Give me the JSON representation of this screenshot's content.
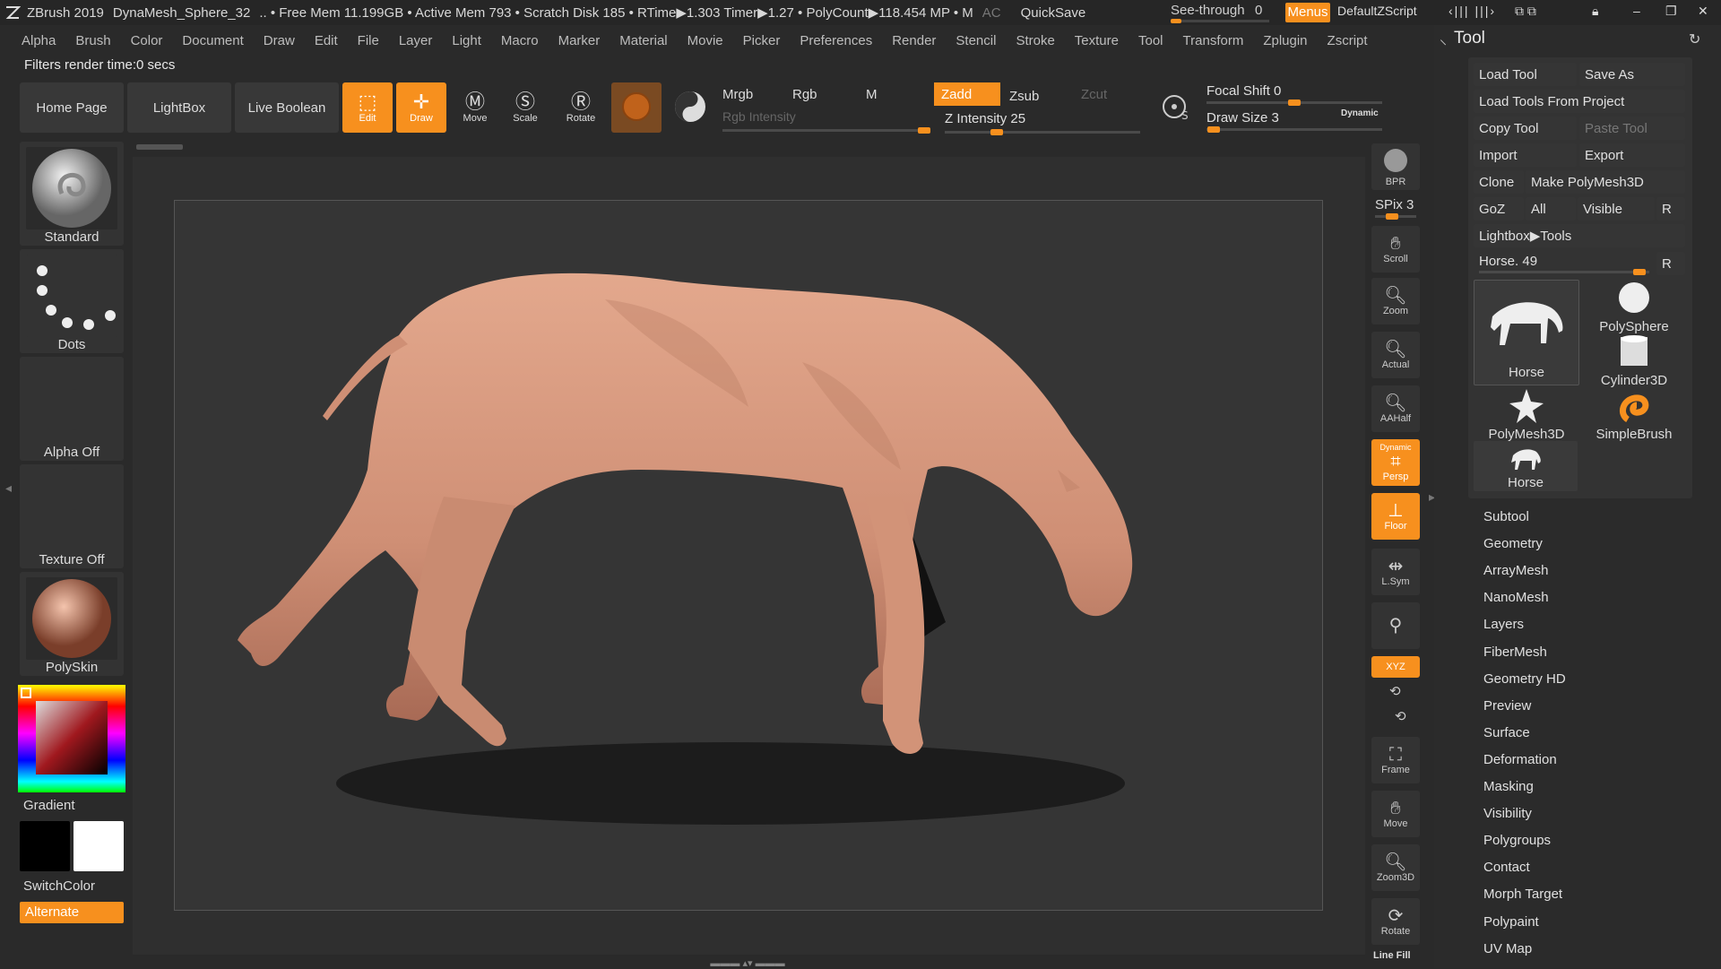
{
  "titlebar": {
    "app": "ZBrush 2019",
    "doc": "DynaMesh_Sphere_32",
    "stats": ".. • Free Mem 11.199GB • Active Mem 793 • Scratch Disk 185 • RTime▶1.303 Timer▶1.27 • PolyCount▶118.454 MP • M",
    "ac": "AC",
    "quicksave": "QuickSave",
    "seethrough_label": "See-through",
    "seethrough_value": "0",
    "seethrough_level": 0,
    "menus": "Menus",
    "script": "DefaultZScript"
  },
  "menubar": [
    "Alpha",
    "Brush",
    "Color",
    "Document",
    "Draw",
    "Edit",
    "File",
    "Layer",
    "Light",
    "Macro",
    "Marker",
    "Material",
    "Movie",
    "Picker",
    "Preferences",
    "Render",
    "Stencil",
    "Stroke",
    "Texture",
    "Tool",
    "Transform",
    "Zplugin",
    "Zscript"
  ],
  "status": "Filters render time:0 secs",
  "toolbar": {
    "home": "Home Page",
    "lightbox": "LightBox",
    "liveboolean": "Live Boolean",
    "edit": "Edit",
    "draw": "Draw",
    "move": "Move",
    "scale": "Scale",
    "rotate": "Rotate",
    "mrgb": "Mrgb",
    "rgb": "Rgb",
    "m": "M",
    "zadd": "Zadd",
    "zsub": "Zsub",
    "zcut": "Zcut",
    "rgb_intensity": "Rgb Intensity",
    "z_intensity": "Z Intensity 25",
    "focal_shift": "Focal Shift 0",
    "draw_size": "Draw Size 3",
    "dynamic": "Dynamic",
    "z_intensity_value": 25,
    "focal_shift_value": 0,
    "draw_size_value": 3
  },
  "left": {
    "brush": "Standard",
    "stroke": "Dots",
    "alpha": "Alpha Off",
    "texture": "Texture Off",
    "material": "PolySkin",
    "gradient": "Gradient",
    "switchcolor": "SwitchColor",
    "alternate": "Alternate"
  },
  "shelf": {
    "bpr": "BPR",
    "spix": "SPix 3",
    "scroll": "Scroll",
    "zoom": "Zoom",
    "actual": "Actual",
    "aahalf": "AAHalf",
    "dynamic": "Dynamic",
    "persp": "Persp",
    "floor": "Floor",
    "lsym": "L.Sym",
    "xyz": "XYZ",
    "frame": "Frame",
    "move": "Move",
    "zoom3d": "Zoom3D",
    "rotate": "Rotate",
    "linefill": "Line Fill"
  },
  "tool": {
    "title": "Tool",
    "buttons": {
      "load": "Load Tool",
      "saveas": "Save As",
      "loadproj": "Load Tools From Project",
      "copy": "Copy Tool",
      "paste": "Paste Tool",
      "import": "Import",
      "export": "Export",
      "clone": "Clone",
      "makepoly": "Make PolyMesh3D",
      "goz": "GoZ",
      "all": "All",
      "visible": "Visible",
      "r": "R",
      "lightbox": "Lightbox▶Tools"
    },
    "slider_label": "Horse. 49",
    "slider_value": 49,
    "thumbs": [
      "Horse",
      "PolySphere",
      "Cylinder3D",
      "PolyMesh3D",
      "SimpleBrush",
      "Horse"
    ],
    "subpalettes": [
      "Subtool",
      "Geometry",
      "ArrayMesh",
      "NanoMesh",
      "Layers",
      "FiberMesh",
      "Geometry HD",
      "Preview",
      "Surface",
      "Deformation",
      "Masking",
      "Visibility",
      "Polygroups",
      "Contact",
      "Morph Target",
      "Polypaint",
      "UV Map"
    ]
  },
  "colors": {
    "accent": "#f7901e",
    "skin": "#d99a80",
    "bg": "#2a2a2a"
  }
}
